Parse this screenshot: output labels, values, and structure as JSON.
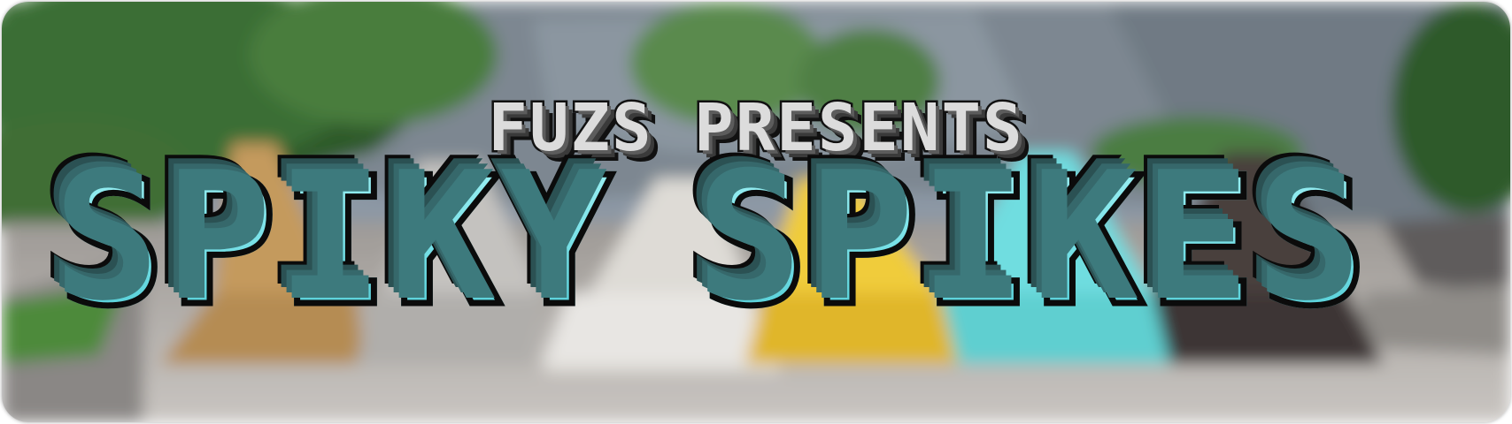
{
  "banner": {
    "subtitle": "FUZS PRESENTS",
    "title_word_1": "SPIKY",
    "title_word_2": "SPIKES"
  },
  "colors": {
    "title_fill": "#7de3e9",
    "title_shade": "#3d7a7d",
    "subtitle_fill": "#dcdcdc",
    "outline": "#111111"
  }
}
